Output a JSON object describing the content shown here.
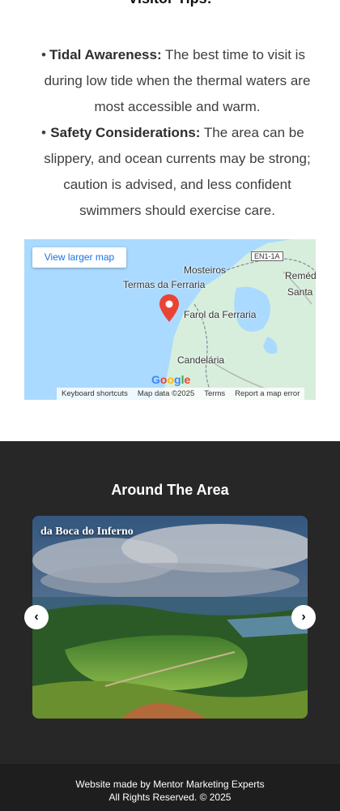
{
  "visitor_tips": {
    "heading": "Visitor Tips:",
    "items": [
      {
        "title": "Tidal Awareness:",
        "text": " The best time to visit is during low tide when the thermal waters are most accessible and warm."
      },
      {
        "title": "Safety Considerations:",
        "text": " The area can be slippery, and ocean currents may be strong; caution is advised, and less confident swimmers should exercise care."
      }
    ]
  },
  "map": {
    "view_larger": "View larger map",
    "labels": {
      "termas": "Termas da Ferraria",
      "farol": "Farol da Ferraria",
      "mosteiros": "Mosteiros",
      "remed": "Reméd",
      "santa": "Santa",
      "candelaria": "Candelária",
      "road": "EN1-1A"
    },
    "footer": {
      "shortcuts": "Keyboard shortcuts",
      "map_data": "Map data ©2025",
      "terms": "Terms",
      "report": "Report a map error"
    }
  },
  "around": {
    "title": "Around The Area",
    "slide_caption": "da Boca do Inferno",
    "prev_icon": "chevron-left-icon",
    "next_icon": "chevron-right-icon"
  },
  "footer": {
    "line1": "Website made by Mentor Marketing Experts",
    "line2": "All Rights Reserved. © 2025"
  }
}
